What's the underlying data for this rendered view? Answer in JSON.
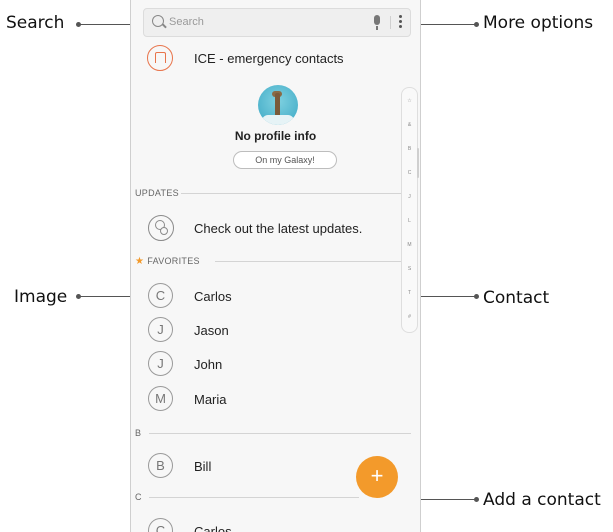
{
  "callouts": {
    "search": "Search",
    "more_options": "More options",
    "image": "Image",
    "contact": "Contact",
    "add_contact": "Add a contact"
  },
  "search": {
    "placeholder": "Search"
  },
  "ice": {
    "label": "ICE - emergency contacts"
  },
  "profile": {
    "title": "No profile info",
    "account": "On my Galaxy!"
  },
  "sections": {
    "updates": "UPDATES",
    "favorites": "FAVORITES",
    "b": "B",
    "c": "C"
  },
  "updates_item": {
    "label": "Check out the latest updates."
  },
  "favorites": [
    {
      "initial": "C",
      "name": "Carlos"
    },
    {
      "initial": "J",
      "name": "Jason"
    },
    {
      "initial": "J",
      "name": "John"
    },
    {
      "initial": "M",
      "name": "Maria"
    }
  ],
  "b_contacts": [
    {
      "initial": "B",
      "name": "Bill"
    }
  ],
  "c_contacts": [
    {
      "initial": "C",
      "name": "Carlos"
    }
  ],
  "index_letters": [
    "☆",
    "&",
    "B",
    "C",
    "J",
    "L",
    "M",
    "S",
    "T",
    "#"
  ],
  "fab": {
    "symbol": "+"
  },
  "colors": {
    "accent": "#f39a2b",
    "ice": "#e8744b"
  },
  "icons": {
    "search": "search-icon",
    "mic": "microphone-icon",
    "more": "more-options-icon",
    "ice": "emergency-icon",
    "updates": "updates-icon",
    "favorites": "star-icon"
  }
}
